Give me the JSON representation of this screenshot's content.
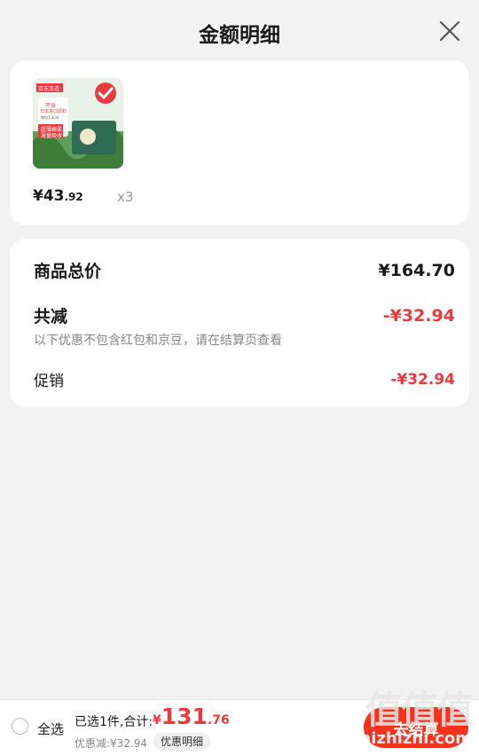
{
  "header": {
    "title": "金额明细"
  },
  "product": {
    "price_int": "¥43",
    "price_dec": ".92",
    "qty": "x3",
    "badge_text": "京东京造",
    "img_lines": [
      "不含",
      "日本进口原料",
      "每包1.1cm",
      "超薄棉柔",
      "海量吸收"
    ]
  },
  "summary": {
    "total_label": "商品总价",
    "total_value": "¥164.70",
    "reduce_label": "共减",
    "reduce_value": "-¥32.94",
    "note": "以下优惠不包含红包和京豆，请在结算页查看",
    "promo_label": "促销",
    "promo_value": "-¥32.94"
  },
  "footer": {
    "select_all": "全选",
    "selected_info": "已选1件,合计:",
    "total_cur": "¥",
    "total_int": "131",
    "total_dec": ".76",
    "discount": "优惠减:¥32.94",
    "detail_button": "优惠明细",
    "checkout": "去结算"
  },
  "watermark": {
    "logo": "值值值",
    "url": "zhizhizhi.com"
  },
  "colors": {
    "accent_red": "#e93b3d",
    "checkout_red": "#f5321e",
    "bg": "#f2f2f2"
  }
}
